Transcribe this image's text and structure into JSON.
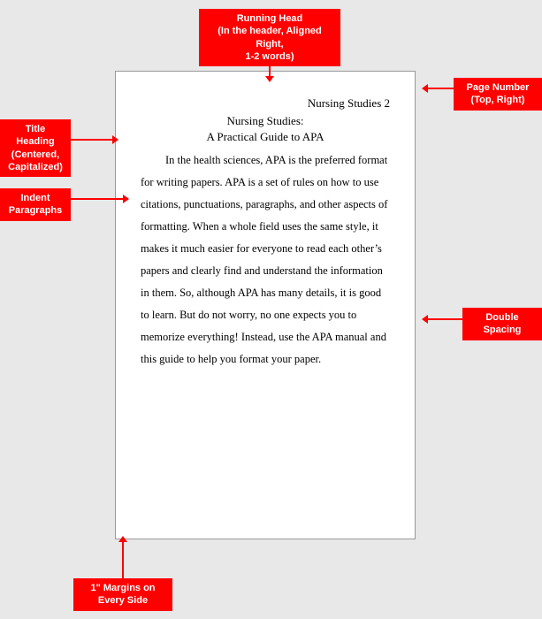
{
  "annotations": {
    "running_head_label": "Running Head\n(In the header, Aligned Right,\n1-2 words)",
    "page_number_label": "Page Number\n(Top, Right)",
    "title_heading_label": "Title Heading\n(Centered,\nCapitalized)",
    "indent_paragraphs_label": "Indent\nParagraphs",
    "double_spacing_label": "Double\nSpacing",
    "margins_label": "1\" Margins on\nEvery Side"
  },
  "document": {
    "header": "Nursing Studies   2",
    "title_line1": "Nursing Studies:",
    "title_line2": "A Practical Guide to APA",
    "body_text": "In the health sciences, APA is the preferred format for writing papers.  APA is a set of rules on how to use citations, punctuations, paragraphs, and other aspects of formatting.  When a whole field uses the same style, it makes it much easier for everyone to read each other’s papers and clearly find and understand the information in them.  So, although APA has many details, it is good to learn.  But do not worry, no one expects you to memorize everything!  Instead, use the APA manual and this guide to help you format your paper."
  }
}
